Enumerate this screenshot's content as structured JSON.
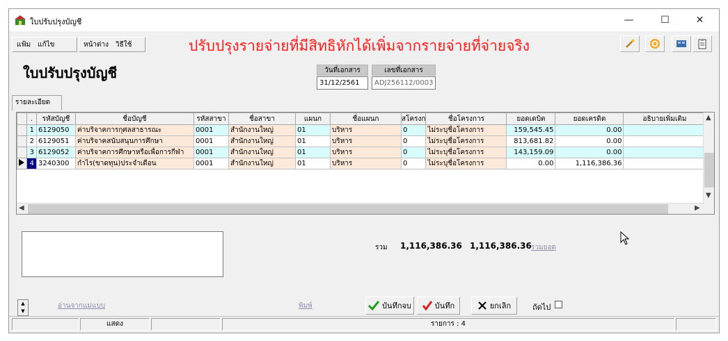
{
  "window": {
    "title": "ใบปรับปรุงบัญชี"
  },
  "titlebar_buttons": {
    "minimize": "—",
    "maximize": "☐",
    "close": "✕"
  },
  "menu": {
    "group1": [
      "แฟ้ม",
      "แก้ไข"
    ],
    "group2": [
      "หน้าต่าง",
      "วิธีใช้"
    ]
  },
  "banner": "ปรับปรุงรายจ่ายที่มีสิทธิหักได้เพิ่มจากรายจ่ายที่จ่ายจริง",
  "document": {
    "title": "ใบปรับปรุงบัญชี",
    "date_label": "วันที่เอกสาร",
    "date_value": "31/12/2561",
    "docno_label": "เลขที่เอกสาร",
    "docno_value": "ADJ256112/0003"
  },
  "tab": {
    "label": "รายละเอียด"
  },
  "grid": {
    "columns": [
      ".",
      "รหัสบัญชี",
      "ชื่อบัญชี",
      "รหัสสาขา",
      "ชื่อสาขา",
      "แผนก",
      "ชื่อแผนก",
      "สโครงก",
      "ชื่อโครงการ",
      "ยอดเดบิต",
      "ยอดเครดิต",
      "อธิบายเพิ่มเติม"
    ],
    "rows": [
      {
        "no": "1",
        "account": "6129050",
        "name": "ค่าบริจาคการกุศลสาธารณะ",
        "branch": "0001",
        "branch_name": "สำนักงานใหญ่",
        "dept": "01",
        "dept_name": "บริหาร",
        "proj": "0",
        "proj_name": "ไม่ระบุชื่อโครงการ",
        "debit": "159,545.45",
        "credit": "0.00",
        "note": ""
      },
      {
        "no": "2",
        "account": "6129051",
        "name": "ค่าบริจาคสนับสนุนการศึกษา",
        "branch": "0001",
        "branch_name": "สำนักงานใหญ่",
        "dept": "01",
        "dept_name": "บริหาร",
        "proj": "0",
        "proj_name": "ไม่ระบุชื่อโครงการ",
        "debit": "813,681.82",
        "credit": "0.00",
        "note": ""
      },
      {
        "no": "3",
        "account": "6129052",
        "name": "ค่าบริจาคการศึกษาหรือเพื่อการกีฬา",
        "branch": "0001",
        "branch_name": "สำนักงานใหญ่",
        "dept": "01",
        "dept_name": "บริหาร",
        "proj": "0",
        "proj_name": "ไม่ระบุชื่อโครงการ",
        "debit": "143,159.09",
        "credit": "0.00",
        "note": ""
      },
      {
        "no": "4",
        "account": "3240300",
        "name": "กำไร(ขาดทุน)ประจำเดือน",
        "branch": "0001",
        "branch_name": "สำนักงานใหญ่",
        "dept": "01",
        "dept_name": "บริหาร",
        "proj": "0",
        "proj_name": "ไม่ระบุชื่อโครงการ",
        "debit": "0.00",
        "credit": "1,116,386.36",
        "note": ""
      }
    ]
  },
  "totals": {
    "label": "รวม",
    "debit": "1,116,386.36",
    "credit": "1,116,386.36",
    "sum_link": "รวมยอด"
  },
  "footer": {
    "read_template": "อ่านจากแม่แบบ",
    "print": "พิมพ์",
    "save_close": "บันทึกจบ",
    "save": "บันทึก",
    "cancel": "ยกเลิก",
    "next_label": "ถัดไป"
  },
  "status": {
    "mode": "แสดง",
    "count": "รายการ : 4"
  }
}
